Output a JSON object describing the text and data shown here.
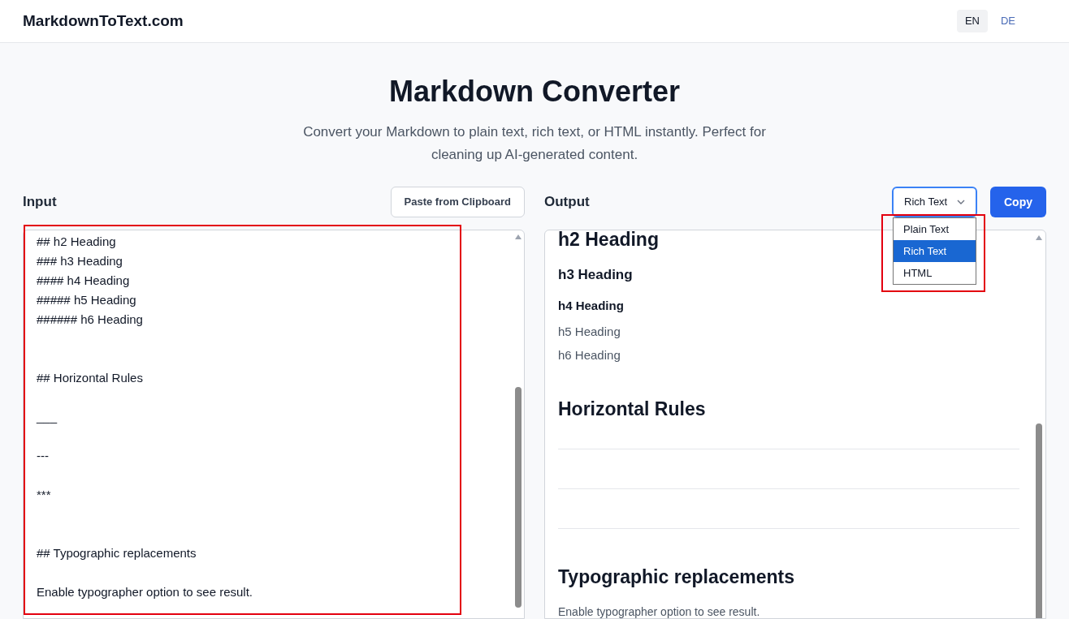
{
  "header": {
    "logo": "MarkdownToText.com",
    "languages": [
      {
        "label": "EN",
        "selected": true
      },
      {
        "label": "DE",
        "selected": false
      }
    ]
  },
  "hero": {
    "title": "Markdown Converter",
    "subtitle": "Convert your Markdown to plain text, rich text, or HTML instantly. Perfect for cleaning up AI-generated content."
  },
  "input": {
    "label": "Input",
    "paste_button": "Paste from Clipboard",
    "value": "## h2 Heading\n### h3 Heading\n#### h4 Heading\n##### h5 Heading\n###### h6 Heading\n\n\n## Horizontal Rules\n\n___\n\n---\n\n***\n\n\n## Typographic replacements\n\nEnable typographer option to see result.",
    "highlighted": true
  },
  "output": {
    "label": "Output",
    "format_select": {
      "value": "Rich Text",
      "expanded": true,
      "highlighted": true,
      "options": [
        {
          "label": "Plain Text",
          "selected": false
        },
        {
          "label": "Rich Text",
          "selected": true
        },
        {
          "label": "HTML",
          "selected": false
        }
      ]
    },
    "copy_button": "Copy",
    "blocks": [
      {
        "kind": "h2",
        "text": "h2 Heading"
      },
      {
        "kind": "h3",
        "text": "h3 Heading"
      },
      {
        "kind": "h4",
        "text": "h4 Heading"
      },
      {
        "kind": "h5",
        "text": "h5 Heading"
      },
      {
        "kind": "h6",
        "text": "h6 Heading"
      },
      {
        "kind": "h2",
        "text": "Horizontal Rules"
      },
      {
        "kind": "hr"
      },
      {
        "kind": "hr"
      },
      {
        "kind": "hr"
      },
      {
        "kind": "h2",
        "text": "Typographic replacements"
      },
      {
        "kind": "p",
        "text": "Enable typographer option to see result."
      }
    ]
  }
}
